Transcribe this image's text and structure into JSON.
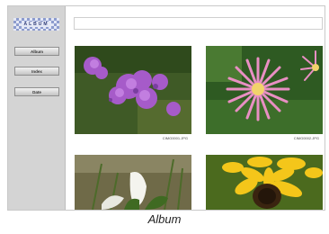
{
  "sidebar": {
    "logo_text": "ALBUM",
    "buttons": [
      {
        "label": "Album"
      },
      {
        "label": "Index"
      },
      {
        "label": "Date"
      }
    ]
  },
  "header": {
    "title_value": ""
  },
  "photos": [
    {
      "filename": "CIMG0001.JPG",
      "subject": "purple verbena flowers"
    },
    {
      "filename": "CIMG0002.JPG",
      "subject": "pink ice plant flower"
    },
    {
      "filename": "",
      "subject": "white calla lily"
    },
    {
      "filename": "",
      "subject": "yellow sunflower"
    }
  ],
  "caption": "Album",
  "colors": {
    "sidebar": "#d4d4d4",
    "logo_pattern": "#8d9cce"
  }
}
